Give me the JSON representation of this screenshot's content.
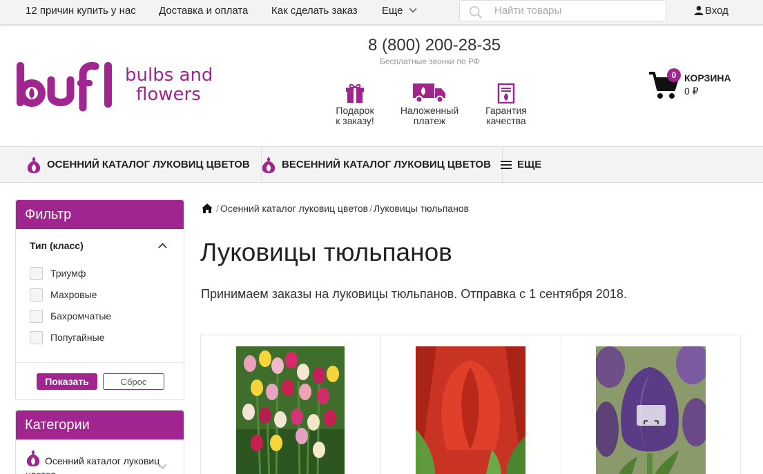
{
  "topbar": {
    "links": [
      "12 причин купить у нас",
      "Доставка и оплата",
      "Как сделать заказ",
      "Еще"
    ],
    "search_placeholder": "Найти товары",
    "login": "Вход"
  },
  "header": {
    "logo_text": "bufl",
    "logo_tagline_line1": "bulbs and",
    "logo_tagline_line2": "flowers",
    "phone": "8 (800) 200-28-35",
    "phone_note": "Бесплатные звонки по РФ",
    "features": [
      {
        "icon": "gift-icon",
        "line1": "Подарок",
        "line2": "к заказу!"
      },
      {
        "icon": "delivery-truck-icon",
        "line1": "Наложенный",
        "line2": "платеж"
      },
      {
        "icon": "quality-certificate-icon",
        "line1": "Гарантия",
        "line2": "качества"
      }
    ],
    "cart": {
      "count": "0",
      "label": "КОРЗИНА",
      "sum": "0 ₽"
    }
  },
  "nav": {
    "items": [
      "ОСЕННИЙ КАТАЛОГ ЛУКОВИЦ ЦВЕТОВ",
      "ВЕСЕННИЙ КАТАЛОГ ЛУКОВИЦ ЦВЕТОВ",
      "ЕЩЕ"
    ]
  },
  "filter": {
    "title": "Фильтр",
    "group_title": "Тип (класс)",
    "options": [
      "Триумф",
      "Махровые",
      "Бахромчатые",
      "Попугайные"
    ],
    "show_button": "Показать",
    "reset_button": "Сброс"
  },
  "categories": {
    "title": "Категории",
    "items": [
      "Осенний каталог луковиц цветов"
    ]
  },
  "breadcrumb": {
    "items": [
      "Осенний каталог луковиц цветов",
      "Луковицы тюльпанов"
    ]
  },
  "main": {
    "title": "Луковицы тюльпанов",
    "intro": "Принимаем заказы на луковицы тюльпанов. Отправка с 1 сентября 2018."
  },
  "colors": {
    "brand": "#a0258f",
    "topbar_bg": "#f3f3f3"
  },
  "products": [
    {
      "image": "mixed-tulips-image"
    },
    {
      "image": "red-tulip-image"
    },
    {
      "image": "purple-tulip-image"
    }
  ]
}
